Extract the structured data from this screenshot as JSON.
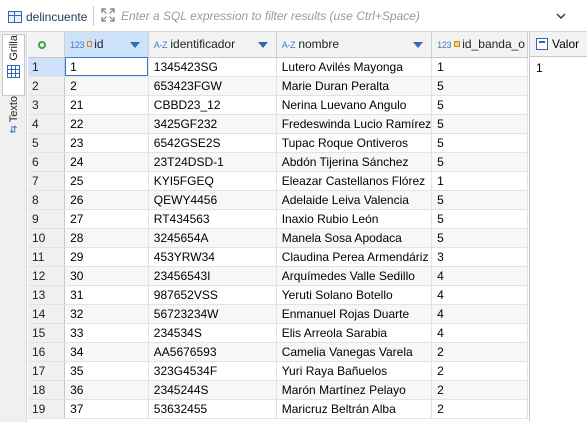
{
  "filter_bar": {
    "table_name": "delincuente",
    "filter_placeholder": "Enter a SQL expression to filter results (use Ctrl+Space)"
  },
  "side_tabs": {
    "grid_label": "Grilla",
    "text_label": "Texto"
  },
  "grid": {
    "columns": [
      {
        "type": "123",
        "name": "id"
      },
      {
        "type": "A-Z",
        "name": "identificador"
      },
      {
        "type": "A-Z",
        "name": "nombre"
      },
      {
        "type": "123",
        "name": "id_banda_o"
      }
    ],
    "rows": [
      {
        "n": "1",
        "id": "1",
        "identificador": "1345423SG",
        "nombre": "Lutero Avilés Mayonga",
        "banda": "1"
      },
      {
        "n": "2",
        "id": "2",
        "identificador": "653423FGW",
        "nombre": "Marie Duran Peralta",
        "banda": "5"
      },
      {
        "n": "3",
        "id": "21",
        "identificador": "CBBD23_12",
        "nombre": "Nerina Luevano Angulo",
        "banda": "5"
      },
      {
        "n": "4",
        "id": "22",
        "identificador": "3425GF232",
        "nombre": "Fredeswinda Lucio Ramírez",
        "banda": "5"
      },
      {
        "n": "5",
        "id": "23",
        "identificador": "6542GSE2S",
        "nombre": "Tupac Roque Ontiveros",
        "banda": "5"
      },
      {
        "n": "6",
        "id": "24",
        "identificador": "23T24DSD-1",
        "nombre": "Abdón Tijerina Sánchez",
        "banda": "5"
      },
      {
        "n": "7",
        "id": "25",
        "identificador": "KYI5FGEQ",
        "nombre": "Eleazar Castellanos Flórez",
        "banda": "1"
      },
      {
        "n": "8",
        "id": "26",
        "identificador": "QEWY4456",
        "nombre": "Adelaide Leiva Valencia",
        "banda": "5"
      },
      {
        "n": "9",
        "id": "27",
        "identificador": "RT434563",
        "nombre": "Inaxio Rubio León",
        "banda": "5"
      },
      {
        "n": "10",
        "id": "28",
        "identificador": "3245654A",
        "nombre": "Manela Sosa Apodaca",
        "banda": "5"
      },
      {
        "n": "11",
        "id": "29",
        "identificador": "453YRW34",
        "nombre": "Claudina Perea Armendáriz",
        "banda": "3"
      },
      {
        "n": "12",
        "id": "30",
        "identificador": "23456543I",
        "nombre": "Arquímedes Valle Sedillo",
        "banda": "4"
      },
      {
        "n": "13",
        "id": "31",
        "identificador": "987652VSS",
        "nombre": "Yeruti Solano Botello",
        "banda": "4"
      },
      {
        "n": "14",
        "id": "32",
        "identificador": "56723234W",
        "nombre": "Enmanuel Rojas Duarte",
        "banda": "4"
      },
      {
        "n": "15",
        "id": "33",
        "identificador": "234534S",
        "nombre": "Elis Arreola Sarabia",
        "banda": "4"
      },
      {
        "n": "16",
        "id": "34",
        "identificador": "AA5676593",
        "nombre": "Camelia Vanegas Varela",
        "banda": "2"
      },
      {
        "n": "17",
        "id": "35",
        "identificador": "323G4534F",
        "nombre": "Yuri Raya Bañuelos",
        "banda": "2"
      },
      {
        "n": "18",
        "id": "36",
        "identificador": "2345244S",
        "nombre": "Marón Martínez Pelayo",
        "banda": "2"
      },
      {
        "n": "19",
        "id": "37",
        "identificador": "53632455",
        "nombre": "Maricruz Beltrán Alba",
        "banda": "2"
      }
    ]
  },
  "value_panel": {
    "title": "Valor",
    "value": "1"
  }
}
